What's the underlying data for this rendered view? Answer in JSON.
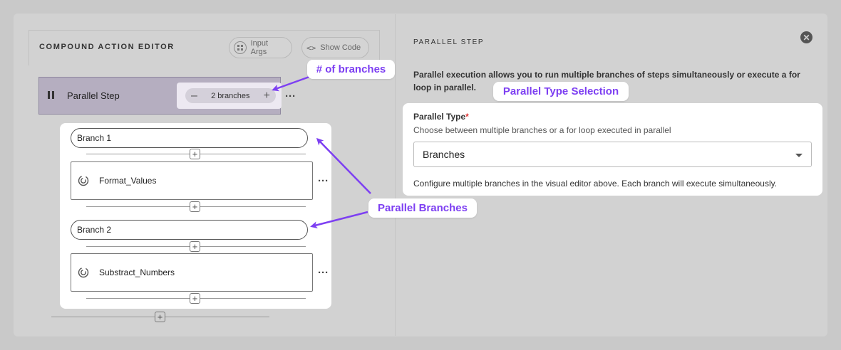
{
  "editor": {
    "title": "COMPOUND ACTION EDITOR",
    "input_args_label": "Input Args",
    "show_code_label": "Show Code",
    "show_code_icon": "<>",
    "parallel_step_label": "Parallel Step",
    "branch_count_label": "2 branches",
    "minus_glyph": "–",
    "plus_glyph": "+",
    "more_glyph": "···",
    "branches": [
      {
        "label": "Branch 1",
        "step": "Format_Values"
      },
      {
        "label": "Branch 2",
        "step": "Substract_Numbers"
      }
    ]
  },
  "panel": {
    "title": "PARALLEL STEP",
    "close_glyph": "✕",
    "description": "Parallel execution allows you to run multiple branches of steps simultaneously or execute a for loop in parallel.",
    "field_label": "Parallel Type",
    "required_mark": "*",
    "field_help": "Choose between multiple branches or a for loop executed in parallel",
    "selected_value": "Branches",
    "note": "Configure multiple branches in the visual editor above. Each branch will execute simultaneously."
  },
  "annotations": {
    "branches_count": "# of branches",
    "type_selection": "Parallel Type Selection",
    "parallel_branches": "Parallel Branches",
    "color": "#7d3ff2"
  }
}
